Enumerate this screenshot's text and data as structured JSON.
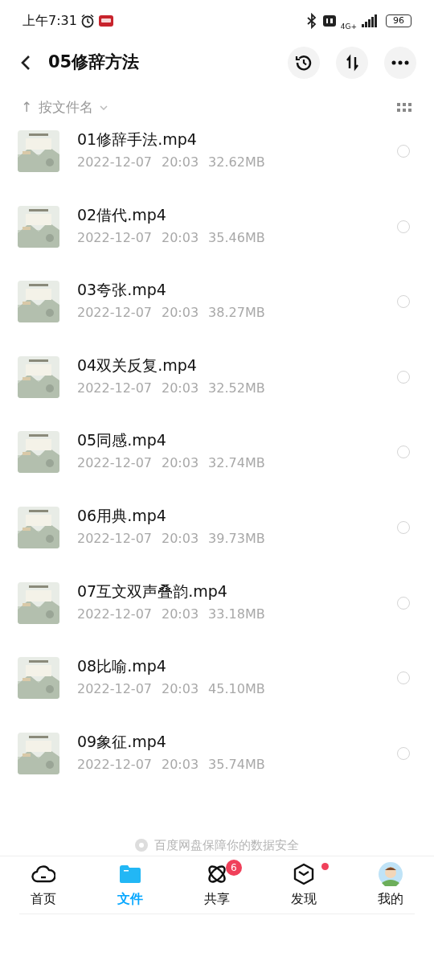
{
  "status_bar": {
    "time": "上午7:31",
    "network": "4G+",
    "battery": "96"
  },
  "header": {
    "title": "05修辞方法"
  },
  "sort": {
    "arrow": "↑",
    "label": "按文件名"
  },
  "files": [
    {
      "name": "01修辞手法.mp4",
      "date": "2022-12-07",
      "time": "20:03",
      "size": "32.62MB",
      "selected": false
    },
    {
      "name": "02借代.mp4",
      "date": "2022-12-07",
      "time": "20:03",
      "size": "35.46MB",
      "selected": false
    },
    {
      "name": "03夸张.mp4",
      "date": "2022-12-07",
      "time": "20:03",
      "size": "38.27MB",
      "selected": false
    },
    {
      "name": "04双关反复.mp4",
      "date": "2022-12-07",
      "time": "20:03",
      "size": "32.52MB",
      "selected": false
    },
    {
      "name": "05同感.mp4",
      "date": "2022-12-07",
      "time": "20:03",
      "size": "32.74MB",
      "selected": false
    },
    {
      "name": "06用典.mp4",
      "date": "2022-12-07",
      "time": "20:03",
      "size": "39.73MB",
      "selected": false
    },
    {
      "name": "07互文双声叠韵.mp4",
      "date": "2022-12-07",
      "time": "20:03",
      "size": "33.18MB",
      "selected": false
    },
    {
      "name": "08比喻.mp4",
      "date": "2022-12-07",
      "time": "20:03",
      "size": "45.10MB",
      "selected": false
    },
    {
      "name": "09象征.mp4",
      "date": "2022-12-07",
      "time": "20:03",
      "size": "35.74MB",
      "selected": false
    }
  ],
  "footer_note": "百度网盘保障你的数据安全",
  "tabs": [
    {
      "kind": "home",
      "label": "首页",
      "selected": false
    },
    {
      "kind": "files",
      "label": "文件",
      "selected": true
    },
    {
      "kind": "share",
      "label": "共享",
      "selected": false,
      "badge": "6"
    },
    {
      "kind": "discover",
      "label": "发现",
      "selected": false,
      "dot": true
    },
    {
      "kind": "me",
      "label": "我的",
      "selected": false
    }
  ]
}
